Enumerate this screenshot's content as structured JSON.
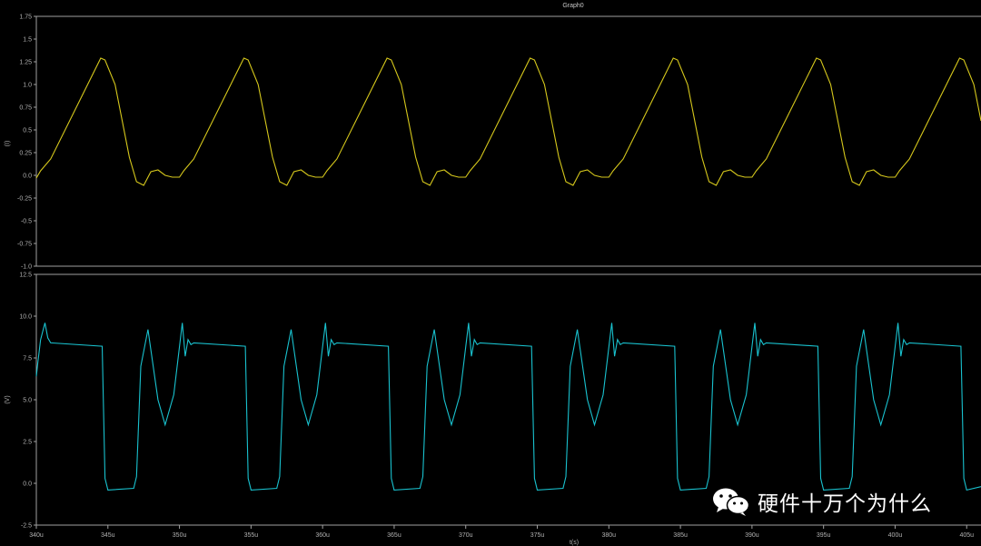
{
  "graph_title": "Graph0",
  "watermark": {
    "text": "硬件十万个为什么",
    "icon": "wechat-icon"
  },
  "colors": {
    "background": "#000000",
    "axis": "#a0a0a0",
    "current": "#d6c81c",
    "voltage": "#19c2cf",
    "text": "#b0b0b0"
  },
  "chart_data": [
    {
      "type": "line",
      "title": "Graph0",
      "xlabel": "",
      "ylabel": "(I)",
      "xlim": [
        340,
        406
      ],
      "ylim": [
        -1.0,
        1.75
      ],
      "yticks": [
        "1.75",
        "1.5",
        "1.25",
        "1.0",
        "0.75",
        "0.5",
        "0.25",
        "0.0",
        "-0.25",
        "-0.5",
        "-0.75",
        "-1.0"
      ],
      "grid": false,
      "period_us": 10,
      "series": [
        {
          "x": [
            340.0,
            340.3,
            341.0,
            344.5,
            344.8,
            345.5,
            346.5,
            347.0,
            347.5,
            348.0,
            348.5,
            349.0,
            349.5,
            350.0,
            350.3,
            351.0,
            354.5,
            354.8,
            355.5,
            356.5,
            357.0,
            357.5,
            358.0,
            358.5,
            359.0,
            359.5,
            360.0,
            360.3,
            361.0,
            364.5,
            364.8,
            365.5,
            366.5,
            367.0,
            367.5,
            368.0,
            368.5,
            369.0,
            369.5,
            370.0,
            370.3,
            371.0,
            374.5,
            374.8,
            375.5,
            376.5,
            377.0,
            377.5,
            378.0,
            378.5,
            379.0,
            379.5,
            380.0,
            380.3,
            381.0,
            384.5,
            384.8,
            385.5,
            386.5,
            387.0,
            387.5,
            388.0,
            388.5,
            389.0,
            389.5,
            390.0,
            390.3,
            391.0,
            394.5,
            394.8,
            395.5,
            396.5,
            397.0,
            397.5,
            398.0,
            398.5,
            399.0,
            399.5,
            400.0,
            400.3,
            401.0,
            404.5,
            404.8,
            405.5,
            406.0
          ],
          "y": [
            -0.03,
            0.05,
            0.18,
            1.29,
            1.27,
            1.0,
            0.2,
            -0.07,
            -0.11,
            0.04,
            0.06,
            0.0,
            -0.02,
            -0.02,
            0.05,
            0.18,
            1.29,
            1.27,
            1.0,
            0.2,
            -0.07,
            -0.11,
            0.04,
            0.06,
            0.0,
            -0.02,
            -0.02,
            0.05,
            0.18,
            1.29,
            1.27,
            1.0,
            0.2,
            -0.07,
            -0.11,
            0.04,
            0.06,
            0.0,
            -0.02,
            -0.02,
            0.05,
            0.18,
            1.29,
            1.27,
            1.0,
            0.2,
            -0.07,
            -0.11,
            0.04,
            0.06,
            0.0,
            -0.02,
            -0.02,
            0.05,
            0.18,
            1.29,
            1.27,
            1.0,
            0.2,
            -0.07,
            -0.11,
            0.04,
            0.06,
            0.0,
            -0.02,
            -0.02,
            0.05,
            0.18,
            1.29,
            1.27,
            1.0,
            0.2,
            -0.07,
            -0.11,
            0.04,
            0.06,
            0.0,
            -0.02,
            -0.02,
            0.05,
            0.18,
            1.29,
            1.27,
            1.0,
            0.6
          ]
        }
      ]
    },
    {
      "type": "line",
      "xlabel": "t(s)",
      "ylabel": "(V)",
      "xlim": [
        340,
        406
      ],
      "ylim": [
        -2.5,
        12.5
      ],
      "yticks": [
        "12.5",
        "10.0",
        "7.5",
        "5.0",
        "2.5",
        "0.0",
        "-2.5"
      ],
      "xticks": [
        "340u",
        "345u",
        "350u",
        "355u",
        "360u",
        "365u",
        "370u",
        "375u",
        "380u",
        "385u",
        "390u",
        "395u",
        "400u",
        "405u"
      ],
      "grid": false,
      "series": [
        {
          "x": [
            340.0,
            340.1,
            340.3,
            340.6,
            340.8,
            341.0,
            344.6,
            344.8,
            345.0,
            346.8,
            347.0,
            347.3,
            347.8,
            348.5,
            349.0,
            349.6,
            350.2,
            350.4,
            350.6,
            350.8,
            351.0,
            354.6,
            354.8,
            355.0,
            356.8,
            357.0,
            357.3,
            357.8,
            358.5,
            359.0,
            359.6,
            360.2,
            360.4,
            360.6,
            360.8,
            361.0,
            364.6,
            364.8,
            365.0,
            366.8,
            367.0,
            367.3,
            367.8,
            368.5,
            369.0,
            369.6,
            370.2,
            370.4,
            370.6,
            370.8,
            371.0,
            374.6,
            374.8,
            375.0,
            376.8,
            377.0,
            377.3,
            377.8,
            378.5,
            379.0,
            379.6,
            380.2,
            380.4,
            380.6,
            380.8,
            381.0,
            384.6,
            384.8,
            385.0,
            386.8,
            387.0,
            387.3,
            387.8,
            388.5,
            389.0,
            389.6,
            390.2,
            390.4,
            390.6,
            390.8,
            391.0,
            394.6,
            394.8,
            395.0,
            396.8,
            397.0,
            397.3,
            397.8,
            398.5,
            399.0,
            399.6,
            400.2,
            400.4,
            400.6,
            400.8,
            401.0,
            404.6,
            404.8,
            405.0,
            406.0
          ],
          "y": [
            6.4,
            7.2,
            8.6,
            9.6,
            8.7,
            8.4,
            8.2,
            0.3,
            -0.4,
            -0.3,
            0.4,
            7.0,
            9.2,
            5.0,
            3.5,
            5.3,
            9.6,
            7.6,
            8.6,
            8.3,
            8.4,
            8.2,
            0.3,
            -0.4,
            -0.3,
            0.4,
            7.0,
            9.2,
            5.0,
            3.5,
            5.3,
            9.6,
            7.6,
            8.6,
            8.3,
            8.4,
            8.2,
            0.3,
            -0.4,
            -0.3,
            0.4,
            7.0,
            9.2,
            5.0,
            3.5,
            5.3,
            9.6,
            7.6,
            8.6,
            8.3,
            8.4,
            8.2,
            0.3,
            -0.4,
            -0.3,
            0.4,
            7.0,
            9.2,
            5.0,
            3.5,
            5.3,
            9.6,
            7.6,
            8.6,
            8.3,
            8.4,
            8.2,
            0.3,
            -0.4,
            -0.3,
            0.4,
            7.0,
            9.2,
            5.0,
            3.5,
            5.3,
            9.6,
            7.6,
            8.6,
            8.3,
            8.4,
            8.2,
            0.3,
            -0.4,
            -0.3,
            0.4,
            7.0,
            9.2,
            5.0,
            3.5,
            5.3,
            9.6,
            7.6,
            8.6,
            8.3,
            8.4,
            8.2,
            0.3,
            -0.4,
            -0.2
          ]
        }
      ]
    }
  ]
}
